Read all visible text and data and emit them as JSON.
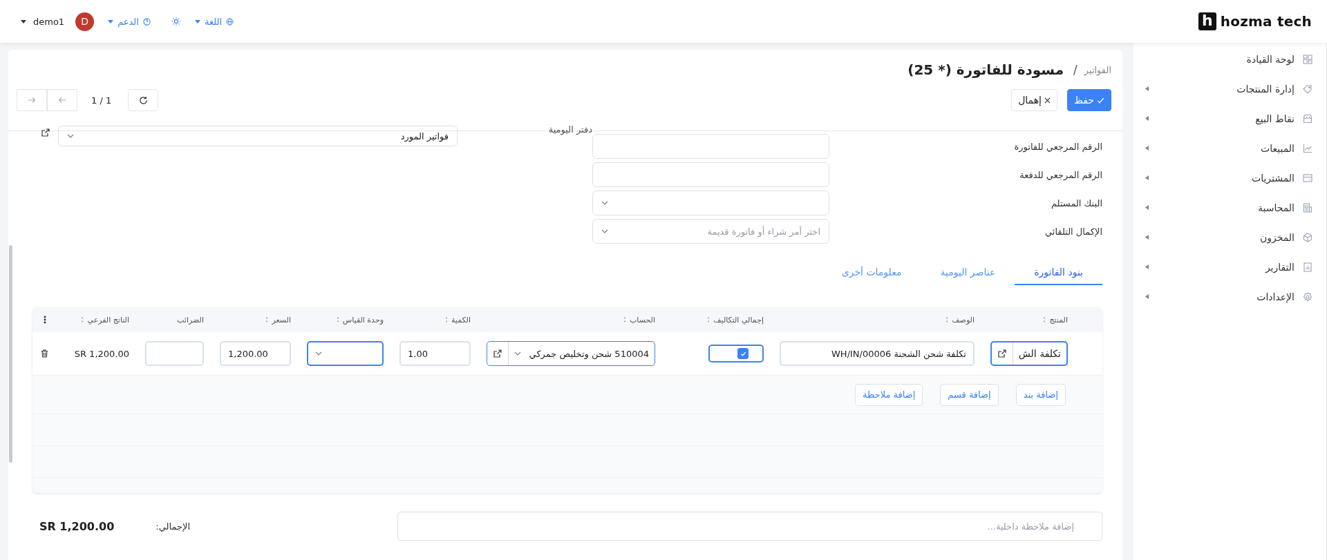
{
  "topbar": {
    "logo_mark": "h",
    "logo": "hozma tech",
    "language": "اللغة",
    "support": "الدعم",
    "user": {
      "initial": "D",
      "name": "demo1"
    }
  },
  "sidebar": {
    "items": [
      {
        "label": "لوحة القيادة",
        "expandable": false
      },
      {
        "label": "إدارة المنتجات",
        "expandable": true
      },
      {
        "label": "نقاط البيع",
        "expandable": true
      },
      {
        "label": "المبيعات",
        "expandable": true
      },
      {
        "label": "المشتريات",
        "expandable": true
      },
      {
        "label": "المحاسبة",
        "expandable": true
      },
      {
        "label": "المخزون",
        "expandable": true
      },
      {
        "label": "التقارير",
        "expandable": true
      },
      {
        "label": "الإعدادات",
        "expandable": true
      }
    ]
  },
  "breadcrumb": "الفواتير",
  "breadcrumb_separator": "/",
  "title": "مسودة للفاتورة (* 25)",
  "actions": [
    {
      "label": "حفظ",
      "kind": "primary"
    },
    {
      "label": "إهمال",
      "kind": "discard"
    }
  ],
  "pager": "1 / 1",
  "form": {
    "fields": [
      {
        "label": "الرقم المرجعي للفاتورة",
        "kind": "text"
      },
      {
        "label": "الرقم المرجعي للدفعة",
        "kind": "text"
      },
      {
        "label": "البنك المستلم",
        "kind": "select"
      },
      {
        "label": "الإكمال التلقائي",
        "kind": "select",
        "placeholder": "اختر أمر شراء أو فاتورة قديمة"
      }
    ],
    "journal": {
      "label": "دفتر اليومية",
      "value": "فواتير المورد"
    }
  },
  "tabs": [
    {
      "label": "بنود الفاتورة",
      "selected": true
    },
    {
      "label": "عناصر اليومية",
      "selected": false
    },
    {
      "label": "معلومات أخرى",
      "selected": false
    }
  ],
  "table": {
    "columns": [
      "المنتج",
      "الوصف",
      "إجمالي التكاليف",
      "الحساب",
      "الكمية",
      "وحدة القياس",
      "السعر",
      "الضرائب",
      "الناتج الفرعي"
    ],
    "rows": [
      {
        "product": "تكلفة الش",
        "description": "تكلفة شحن الشحنة WH/IN/00006",
        "total_costs": true,
        "account": "510004 شحن وتخليص جمركي",
        "quantity": "1.00",
        "price": "1,200.00",
        "subtotal": "SR 1,200.00"
      }
    ],
    "add_buttons": [
      "إضافة بند",
      "إضافة قسم",
      "إضافة ملاحظة"
    ]
  },
  "note": {
    "placeholder": "إضافة ملاحظة داخلية..."
  },
  "total": {
    "label": "الإجمالي:",
    "value": "SR 1,200.00"
  }
}
